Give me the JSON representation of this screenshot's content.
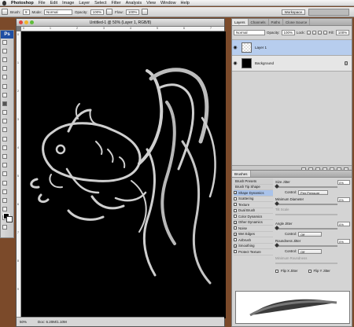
{
  "menubar": {
    "app": "Photoshop",
    "items": [
      "File",
      "Edit",
      "Image",
      "Layer",
      "Select",
      "Filter",
      "Analysis",
      "View",
      "Window",
      "Help"
    ]
  },
  "options": {
    "brush_label": "Brush:",
    "brush_size": "9",
    "mode_label": "Mode:",
    "mode_value": "Normal",
    "opacity_label": "Opacity:",
    "opacity_value": "100%",
    "flow_label": "Flow:",
    "flow_value": "100%",
    "workspace": "Workspace"
  },
  "toolbox": {
    "logo": "Ps"
  },
  "document": {
    "title": "Untitled-1 @ 50% (Layer 1, RGB/8)",
    "zoom": "50%",
    "doc_size": "Doc: 6.20M/1.10M",
    "ruler_top": [
      "0",
      "1",
      "2",
      "3",
      "4",
      "5",
      "6",
      "7"
    ],
    "ruler_left": [
      "0",
      "1",
      "2",
      "3",
      "4",
      "5",
      "6",
      "7",
      "8",
      "9"
    ]
  },
  "layers_panel": {
    "tabs": [
      "Layers",
      "Channels",
      "Paths",
      "Clone Source"
    ],
    "blend_mode": "Normal",
    "opacity_label": "Opacity:",
    "opacity_value": "100%",
    "lock_label": "Lock:",
    "fill_label": "Fill:",
    "fill_value": "100%",
    "layers": [
      {
        "name": "Layer 1",
        "selected": true
      },
      {
        "name": "Background",
        "selected": false
      }
    ]
  },
  "brushes_panel": {
    "tab": "Brushes",
    "list": [
      {
        "label": "Brush Presets",
        "head": true
      },
      {
        "label": "Brush Tip Shape",
        "head": true
      },
      {
        "label": "Shape Dynamics",
        "checked": true,
        "selected": true
      },
      {
        "label": "Scattering",
        "checked": false
      },
      {
        "label": "Texture",
        "checked": false
      },
      {
        "label": "Dual Brush",
        "checked": false
      },
      {
        "label": "Color Dynamics",
        "checked": false
      },
      {
        "label": "Other Dynamics",
        "checked": true
      },
      {
        "label": "Noise",
        "checked": false
      },
      {
        "label": "Wet Edges",
        "checked": true
      },
      {
        "label": "Airbrush",
        "checked": false
      },
      {
        "label": "Smoothing",
        "checked": true
      },
      {
        "label": "Protect Texture",
        "checked": false
      }
    ],
    "size_jitter_label": "Size Jitter",
    "size_jitter_value": "0%",
    "control_label": "Control:",
    "size_control": "Pen Pressure",
    "min_diameter_label": "Minimum Diameter",
    "min_diameter_value": "0%",
    "tilt_scale_label": "Tilt Scale",
    "angle_jitter_label": "Angle Jitter",
    "angle_jitter_value": "0%",
    "angle_control": "Off",
    "roundness_jitter_label": "Roundness Jitter",
    "roundness_jitter_value": "0%",
    "roundness_control": "Off",
    "min_roundness_label": "Minimum Roundness",
    "flip_x_label": "Flip X Jitter",
    "flip_y_label": "Flip Y Jitter"
  }
}
